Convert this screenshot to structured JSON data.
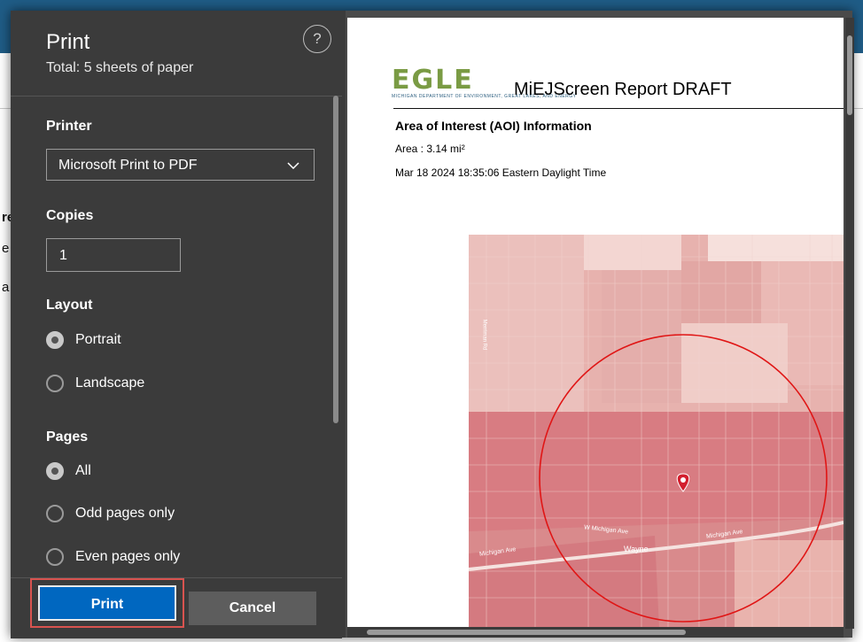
{
  "background": {
    "fragments": [
      "re",
      "e",
      "a"
    ]
  },
  "print_panel": {
    "title": "Print",
    "subtitle": "Total: 5 sheets of paper",
    "help_symbol": "?",
    "printer": {
      "label": "Printer",
      "selected": "Microsoft Print to PDF"
    },
    "copies": {
      "label": "Copies",
      "value": "1"
    },
    "layout": {
      "label": "Layout",
      "options": [
        {
          "label": "Portrait",
          "selected": true
        },
        {
          "label": "Landscape",
          "selected": false
        }
      ]
    },
    "pages": {
      "label": "Pages",
      "options": [
        {
          "label": "All",
          "selected": true
        },
        {
          "label": "Odd pages only",
          "selected": false
        },
        {
          "label": "Even pages only",
          "selected": false
        }
      ]
    },
    "buttons": {
      "print": "Print",
      "cancel": "Cancel"
    }
  },
  "preview": {
    "logo_text": "EGLE",
    "logo_sub": "MICHIGAN DEPARTMENT OF ENVIRONMENT, GREAT LAKES, AND ENERGY",
    "report_title": "MiEJScreen Report DRAFT",
    "aoi_heading": "Area of Interest (AOI) Information",
    "area": "Area : 3.14 mi²",
    "datetime": "Mar 18 2024 18:35:06 Eastern Daylight Time",
    "map_labels": {
      "road_left": "Michigan Ave",
      "road_mid": "W Michigan Ave",
      "road_right": "Michigan Ave",
      "place": "Wayne",
      "vertical_road": "Merriman Rd"
    }
  },
  "colors": {
    "accent": "#0067c0",
    "highlight": "#d9534f",
    "panel": "#3b3b3b",
    "map_pin": "#d31f2e",
    "aoi_circle": "#e01515"
  }
}
